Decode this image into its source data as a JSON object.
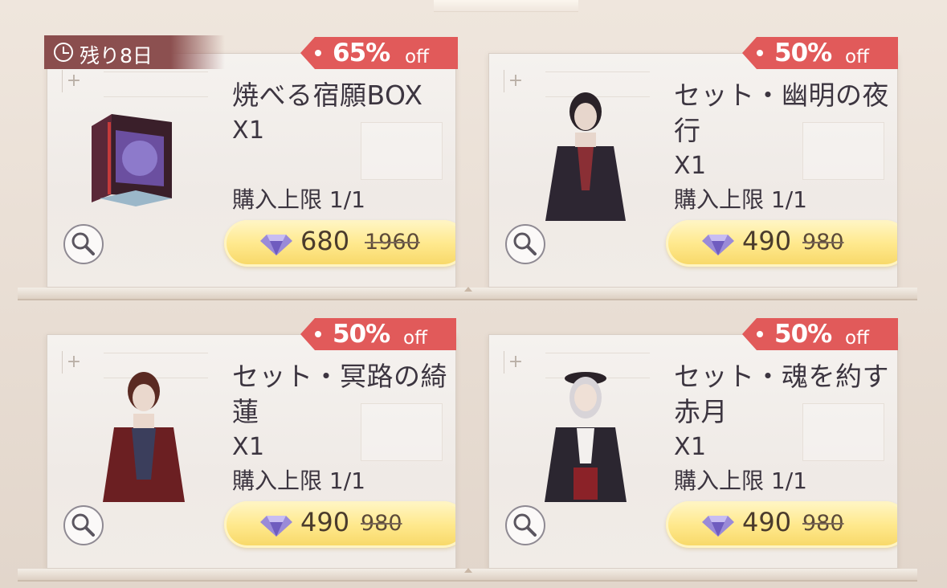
{
  "timer": {
    "label": "残り8日"
  },
  "items": [
    {
      "discount": "65%",
      "off": "off",
      "title": "焼べる宿願BOX",
      "qty": "X1",
      "limit": "購入上限 1/1",
      "price": "680",
      "original": "1960",
      "image": "tribute-box-image"
    },
    {
      "discount": "50%",
      "off": "off",
      "title": "セット・幽明の夜行",
      "qty": "X1",
      "limit": "購入上限 1/1",
      "price": "490",
      "original": "980",
      "image": "outfit-character-image"
    },
    {
      "discount": "50%",
      "off": "off",
      "title": "セット・冥路の綺蓮",
      "qty": "X1",
      "limit": "購入上限 1/1",
      "price": "490",
      "original": "980",
      "image": "outfit-character-image"
    },
    {
      "discount": "50%",
      "off": "off",
      "title": "セット・魂を約す赤月",
      "qty": "X1",
      "limit": "購入上限 1/1",
      "price": "490",
      "original": "980",
      "image": "outfit-character-image"
    }
  ],
  "colors": {
    "tag": "#e15a5a",
    "price_button": "#ffe98e",
    "timer": "#8a4d4d"
  },
  "icons": [
    "clock-icon",
    "search-icon",
    "diamond-icon"
  ]
}
